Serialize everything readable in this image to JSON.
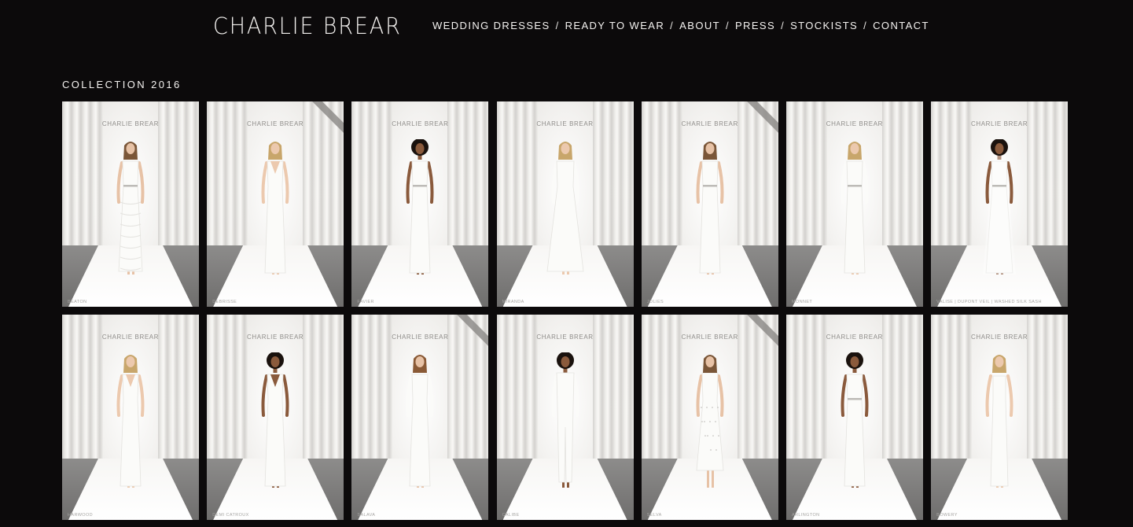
{
  "brand": {
    "logo": "CHARLIE BREAR"
  },
  "nav": {
    "items": [
      "WEDDING DRESSES",
      "READY TO WEAR",
      "ABOUT",
      "PRESS",
      "STOCKISTS",
      "CONTACT"
    ],
    "separator": "/"
  },
  "collection": {
    "title": "COLLECTION 2016",
    "backdrop_sign": "CHARLIE BREAR",
    "items": [
      {
        "caption": "BEATON",
        "ribbon": false,
        "skin": "#e7c2a6",
        "hair": "#7a5638",
        "afro": false,
        "dress": "lace",
        "sleeves": false
      },
      {
        "caption": "DEBRISSE",
        "ribbon": true,
        "skin": "#ecc9ae",
        "hair": "#c8a66b",
        "afro": false,
        "dress": "vneck",
        "sleeves": false
      },
      {
        "caption": "FAVIER",
        "ribbon": false,
        "skin": "#8a5a3c",
        "hair": "#1a120e",
        "afro": true,
        "dress": "column",
        "sleeves": false
      },
      {
        "caption": "MIRANDA",
        "ribbon": false,
        "skin": "#ecc9ae",
        "hair": "#c8a66b",
        "afro": false,
        "dress": "aline",
        "sleeves": true
      },
      {
        "caption": "JOLIES",
        "ribbon": true,
        "skin": "#e7c2a6",
        "hair": "#7a5638",
        "afro": false,
        "dress": "column",
        "sleeves": false
      },
      {
        "caption": "MONNET",
        "ribbon": false,
        "skin": "#ecc9ae",
        "hair": "#c8a66b",
        "afro": false,
        "dress": "column",
        "sleeves": true
      },
      {
        "caption": "VALISE | DUPONT VEIL | WASHED SILK SASH",
        "ribbon": false,
        "skin": "#8a5a3c",
        "hair": "#1a120e",
        "afro": true,
        "dress": "veil",
        "sleeves": false
      },
      {
        "caption": "HARWOOD",
        "ribbon": false,
        "skin": "#ecc9ae",
        "hair": "#c8a66b",
        "afro": false,
        "dress": "vneck",
        "sleeves": false
      },
      {
        "caption": "DEMI CATROUX",
        "ribbon": false,
        "skin": "#8a5a3c",
        "hair": "#1a120e",
        "afro": true,
        "dress": "vneck",
        "sleeves": false
      },
      {
        "caption": "SALAVA",
        "ribbon": true,
        "skin": "#e7c2a6",
        "hair": "#8a5a36",
        "afro": false,
        "dress": "longsleeve",
        "sleeves": true
      },
      {
        "caption": "CALIBE",
        "ribbon": false,
        "skin": "#8a5a3c",
        "hair": "#1a120e",
        "afro": true,
        "dress": "jumpsuit",
        "sleeves": true
      },
      {
        "caption": "SELVA",
        "ribbon": true,
        "skin": "#e7c2a6",
        "hair": "#7a5638",
        "afro": false,
        "dress": "shirtdress",
        "sleeves": false
      },
      {
        "caption": "ARLINGTON",
        "ribbon": false,
        "skin": "#8a5a3c",
        "hair": "#1a120e",
        "afro": true,
        "dress": "column",
        "sleeves": false
      },
      {
        "caption": "BOWERY",
        "ribbon": false,
        "skin": "#ecc9ae",
        "hair": "#c8a66b",
        "afro": false,
        "dress": "slip",
        "sleeves": false
      }
    ]
  }
}
